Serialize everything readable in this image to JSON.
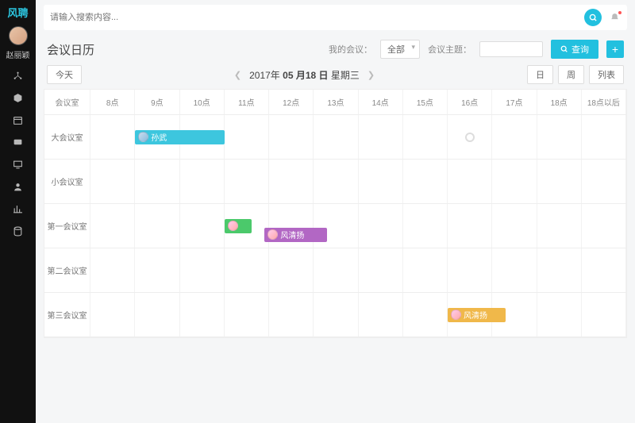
{
  "sidebar": {
    "logo": "风聘",
    "username": "赵丽颖",
    "icons": [
      "org-icon",
      "cube-icon",
      "calendar-icon",
      "chat-icon",
      "monitor-icon",
      "person-icon",
      "chart-icon",
      "db-icon"
    ]
  },
  "search": {
    "placeholder": "请输入搜索内容..."
  },
  "page": {
    "title": "会议日历"
  },
  "filters": {
    "my_meeting_label": "我的会议：",
    "my_meeting_value": "全部",
    "subject_label": "会议主题：",
    "subject_value": "",
    "search_btn": "查询"
  },
  "toolbar": {
    "today": "今天",
    "date_y": "2017年",
    "date_md": "05 月18 日",
    "date_wd": "星期三",
    "view_day": "日",
    "view_week": "周",
    "view_list": "列表"
  },
  "columns": [
    "会议室",
    "8点",
    "9点",
    "10点",
    "11点",
    "12点",
    "13点",
    "14点",
    "15点",
    "16点",
    "17点",
    "18点",
    "18点以后"
  ],
  "rooms": [
    "大会议室",
    "小会议室",
    "第一会议室",
    "第二会议室",
    "第三会议室"
  ],
  "events": [
    {
      "room": 0,
      "start": 1,
      "span": 2,
      "color": "#3dc6de",
      "name": "孙武",
      "av": "m"
    },
    {
      "room": 2,
      "start": 3,
      "span": 0.6,
      "color": "#4bc96b",
      "name": "",
      "av": "f"
    },
    {
      "room": 2,
      "start": 3.9,
      "span": 1.4,
      "color": "#b267c4",
      "name": "风清扬",
      "av": "f",
      "vOffset": 22
    },
    {
      "room": 4,
      "start": 8,
      "span": 1.3,
      "color": "#f0b84a",
      "name": "风清扬",
      "av": "f"
    }
  ],
  "ring": {
    "room": 0,
    "col": 8.5
  }
}
